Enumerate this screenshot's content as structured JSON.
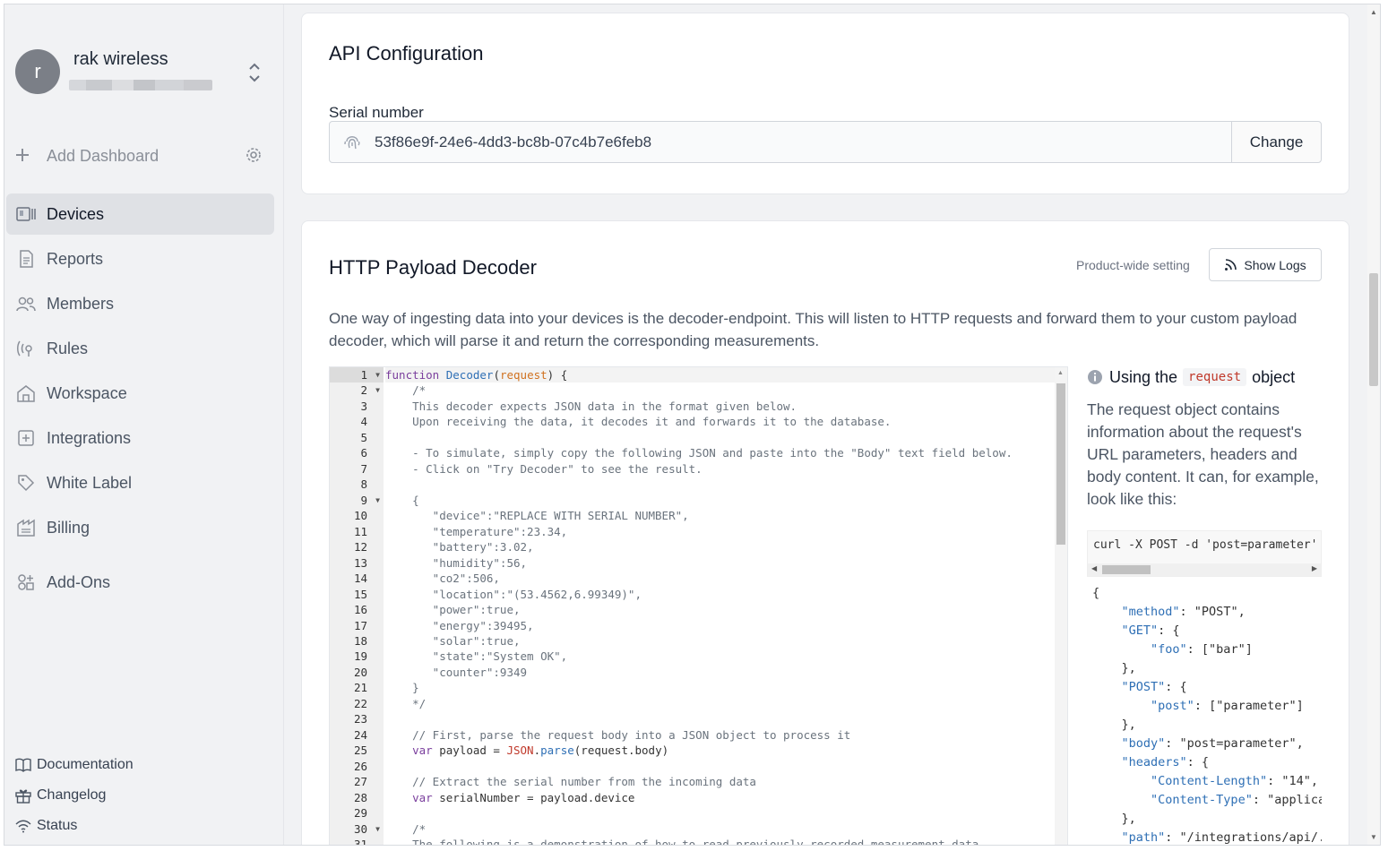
{
  "sidebar": {
    "org": {
      "avatar_letter": "r",
      "name": "rak wireless"
    },
    "add_dashboard": "Add Dashboard",
    "items": [
      {
        "label": "Devices",
        "icon": "devices-icon",
        "active": true
      },
      {
        "label": "Reports",
        "icon": "reports-icon"
      },
      {
        "label": "Members",
        "icon": "members-icon"
      },
      {
        "label": "Rules",
        "icon": "rules-icon"
      },
      {
        "label": "Workspace",
        "icon": "workspace-icon"
      },
      {
        "label": "Integrations",
        "icon": "integrations-icon"
      },
      {
        "label": "White Label",
        "icon": "tag-icon"
      },
      {
        "label": "Billing",
        "icon": "billing-icon"
      },
      {
        "label": "Add-Ons",
        "icon": "addons-icon"
      }
    ],
    "footer": [
      {
        "label": "Documentation",
        "icon": "book-icon"
      },
      {
        "label": "Changelog",
        "icon": "gift-icon"
      },
      {
        "label": "Status",
        "icon": "wifi-icon"
      }
    ]
  },
  "api_config": {
    "title": "API Configuration",
    "serial_label": "Serial number",
    "serial_value": "53f86e9f-24e6-4dd3-bc8b-07c4b7e6feb8",
    "change_label": "Change"
  },
  "decoder": {
    "title": "HTTP Payload Decoder",
    "product_wide": "Product-wide setting",
    "show_logs": "Show Logs",
    "description": "One way of ingesting data into your devices is the decoder-endpoint. This will listen to HTTP requests and forward them to your custom payload decoder, which will parse it and return the corresponding measurements."
  },
  "help": {
    "title_prefix": "Using the",
    "title_code": "request",
    "title_suffix": "object",
    "text": "The request object contains information about the request's URL parameters, headers and body content. It can, for example, look like this:",
    "curl": "curl -X POST -d 'post=parameter' https://"
  }
}
